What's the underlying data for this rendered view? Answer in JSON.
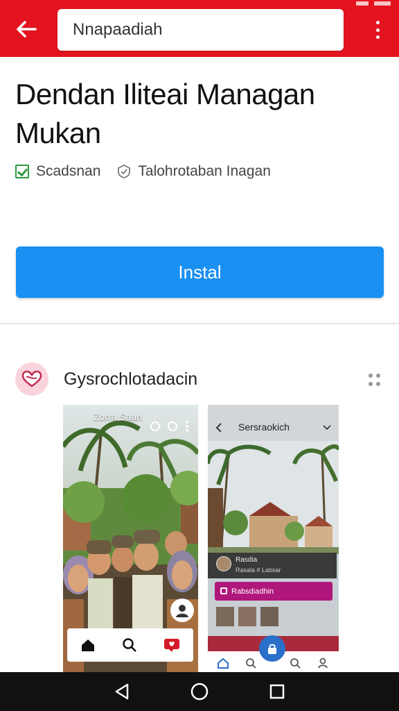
{
  "search": {
    "value": "Nnapaadiah"
  },
  "app": {
    "title": "Dendan Ilitеai Managan Mukan",
    "meta_left": "Scadsnan",
    "meta_right": "Talohrotaban Inagan"
  },
  "install": {
    "label": "Instal"
  },
  "developer": {
    "name": "Gysrochlotadacin"
  },
  "screenshots": {
    "shot1_header": "Zorra Saan",
    "shot2_title": "Sersraokich",
    "shot2_card_name": "Rasdia",
    "shot2_card_sub": "Rasala # Labsar",
    "shot2_pink_label": "Rabsdiadhin"
  },
  "colors": {
    "app_bar": "#e3141f",
    "install_button": "#1a90f3",
    "system_nav": "#111111"
  },
  "icons": {
    "back": "arrow-left-icon",
    "menu": "more-vertical-icon",
    "verified": "check-box-icon",
    "badge": "shield-badge-icon",
    "dev_more": "grid-dots-icon",
    "nav_back": "triangle-back-icon",
    "nav_home": "circle-home-icon",
    "nav_recent": "square-recents-icon"
  }
}
